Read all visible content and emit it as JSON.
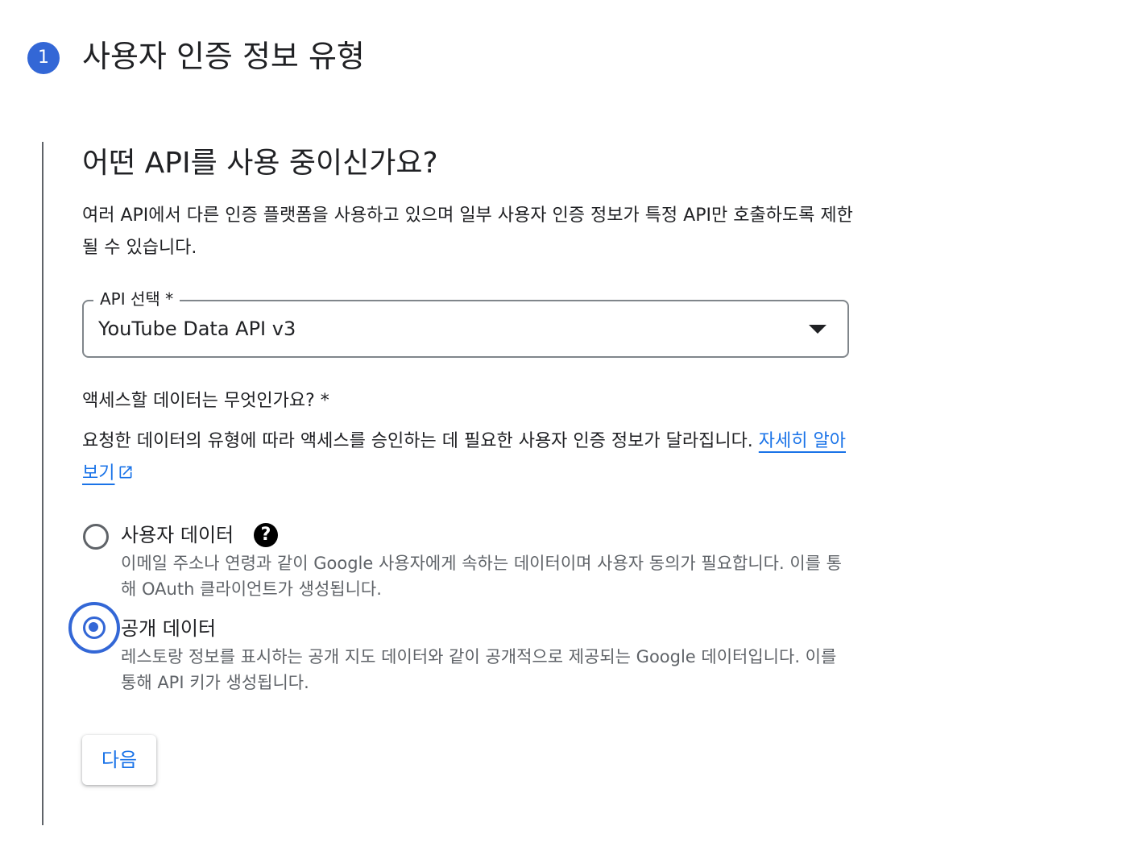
{
  "step": {
    "number": "1",
    "title": "사용자 인증 정보 유형"
  },
  "api_section": {
    "heading": "어떤 API를 사용 중이신가요?",
    "description": "여러 API에서 다른 인증 플랫폼을 사용하고 있으며 일부 사용자 인증 정보가 특정 API만 호출하도록 제한될 수 있습니다.",
    "select": {
      "label": "API 선택 *",
      "value": "YouTube Data API v3"
    }
  },
  "data_section": {
    "question": "액세스할 데이터는 무엇인가요? *",
    "description": "요청한 데이터의 유형에 따라 액세스를 승인하는 데 필요한 사용자 인증 정보가 달라집니다. ",
    "learn_more_link": "자세히 알아보기",
    "options": [
      {
        "label": "사용자 데이터",
        "description": "이메일 주소나 연령과 같이 Google 사용자에게 속하는 데이터이며 사용자 동의가 필요합니다. 이를 통해 OAuth 클라이언트가 생성됩니다.",
        "selected": false,
        "help_icon": "question-circle-icon"
      },
      {
        "label": "공개 데이터",
        "description": "레스토랑 정보를 표시하는 공개 지도 데이터와 같이 공개적으로 제공되는 Google 데이터입니다. 이를 통해 API 키가 생성됩니다.",
        "selected": true
      }
    ]
  },
  "actions": {
    "next_label": "다음"
  },
  "colors": {
    "accent": "#3367d6",
    "link": "#1a73e8",
    "text": "#202124",
    "secondary_text": "#5f6368"
  }
}
